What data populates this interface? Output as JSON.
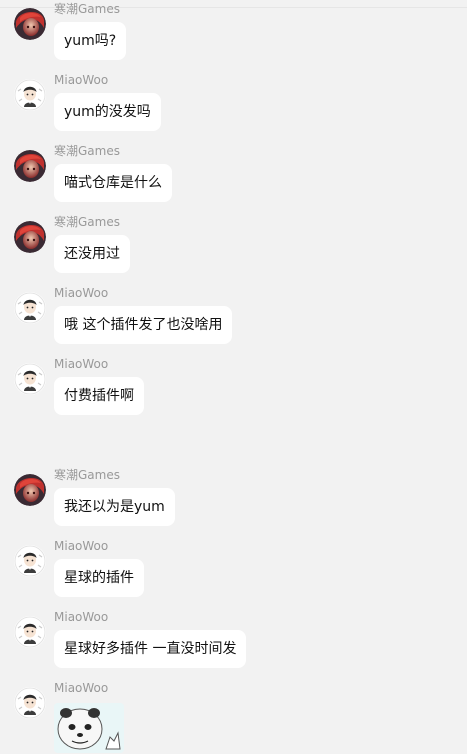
{
  "colors": {
    "background": "#f2f2f2",
    "bubble": "#ffffff",
    "sender_name": "#999999",
    "text": "#111111"
  },
  "messages": [
    {
      "sender": "寒潮Games",
      "avatar": "red-hair-avatar-icon",
      "text": "yum吗?"
    },
    {
      "sender": "MiaoWoo",
      "avatar": "anime-boy-avatar-icon",
      "text": "yum的没发吗"
    },
    {
      "sender": "寒潮Games",
      "avatar": "red-hair-avatar-icon",
      "text": "喵式仓库是什么"
    },
    {
      "sender": "寒潮Games",
      "avatar": "red-hair-avatar-icon",
      "text": "还没用过"
    },
    {
      "sender": "MiaoWoo",
      "avatar": "anime-boy-avatar-icon",
      "text": "哦 这个插件发了也没啥用"
    },
    {
      "sender": "MiaoWoo",
      "avatar": "anime-boy-avatar-icon",
      "text": "付费插件啊"
    },
    {
      "sender": "寒潮Games",
      "avatar": "red-hair-avatar-icon",
      "text": "我还以为是yum"
    },
    {
      "sender": "MiaoWoo",
      "avatar": "anime-boy-avatar-icon",
      "text": "星球的插件"
    },
    {
      "sender": "MiaoWoo",
      "avatar": "anime-boy-avatar-icon",
      "text": "星球好多插件 一直没时间发"
    },
    {
      "sender": "MiaoWoo",
      "avatar": "anime-boy-avatar-icon",
      "image": "panda-meme-sticker-icon"
    }
  ]
}
